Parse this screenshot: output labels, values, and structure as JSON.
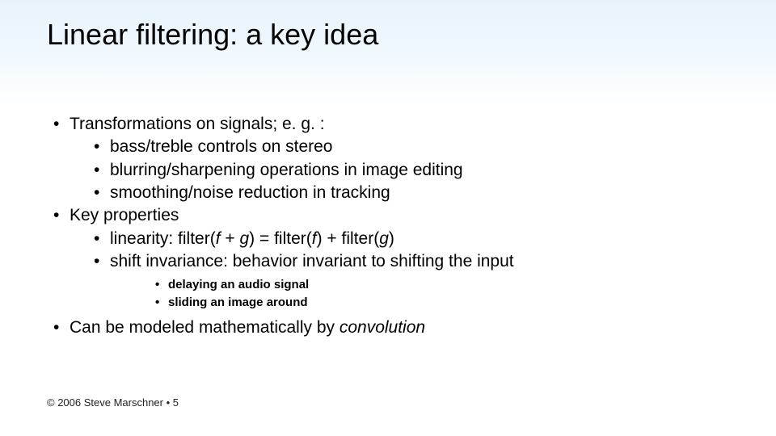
{
  "title": "Linear filtering: a key idea",
  "body": {
    "b1": "Transformations on signals; e. g. :",
    "b1a": "bass/treble controls on stereo",
    "b1b": "blurring/sharpening operations in image editing",
    "b1c": "smoothing/noise reduction in tracking",
    "b2": "Key properties",
    "b2a_pre": "linearity: filter(",
    "b2a_f1": "f",
    "b2a_mid1": " + ",
    "b2a_g1": "g",
    "b2a_mid2": ") = filter(",
    "b2a_f2": "f",
    "b2a_mid3": ") + filter(",
    "b2a_g2": "g",
    "b2a_post": ")",
    "b2b": "shift invariance: behavior invariant to shifting the input",
    "b2b1": "delaying an audio signal",
    "b2b2": "sliding an image around",
    "b3_pre": "Can be modeled mathematically by ",
    "b3_em": "convolution"
  },
  "footer": "© 2006 Steve Marschner • 5"
}
